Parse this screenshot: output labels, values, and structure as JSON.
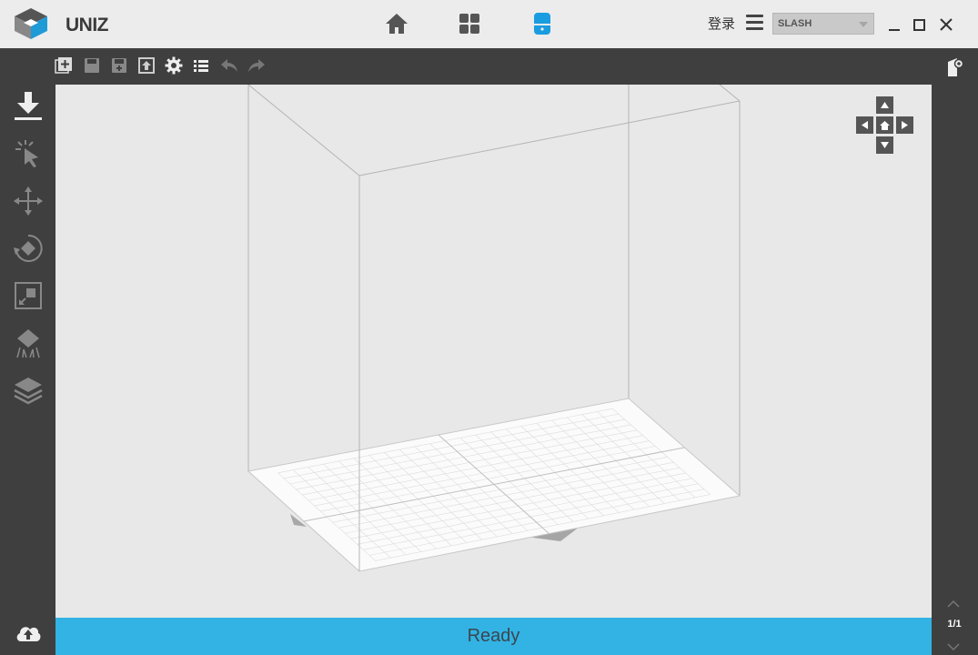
{
  "app": {
    "logo_text": "UNIZ"
  },
  "header": {
    "nav": [
      {
        "name": "home",
        "icon": "home-icon",
        "active": false
      },
      {
        "name": "dashboard",
        "icon": "grid-icon",
        "active": false
      },
      {
        "name": "printer",
        "icon": "printer-icon",
        "active": true
      }
    ],
    "login_label": "登录",
    "printer_select": {
      "value": "SLASH"
    }
  },
  "toolbar": {
    "icons": [
      "add-model-icon",
      "save-icon",
      "save-as-icon",
      "export-icon",
      "settings-icon",
      "list-icon",
      "undo-icon",
      "redo-icon"
    ]
  },
  "sidebar": {
    "tools": [
      "import-icon",
      "select-icon",
      "move-icon",
      "rotate-icon",
      "scale-icon",
      "support-icon",
      "layers-icon"
    ],
    "upload_icon": "cloud-upload-icon"
  },
  "viewport": {
    "nav_controls": [
      "up",
      "left",
      "home",
      "right",
      "down"
    ]
  },
  "status": {
    "text": "Ready"
  },
  "pagination": {
    "label": "1/1"
  },
  "colors": {
    "accent": "#32b3e4",
    "active_nav": "#1a9ce0",
    "dark_panel": "#3f3f3f",
    "viewport_bg": "#e8e8e8"
  }
}
